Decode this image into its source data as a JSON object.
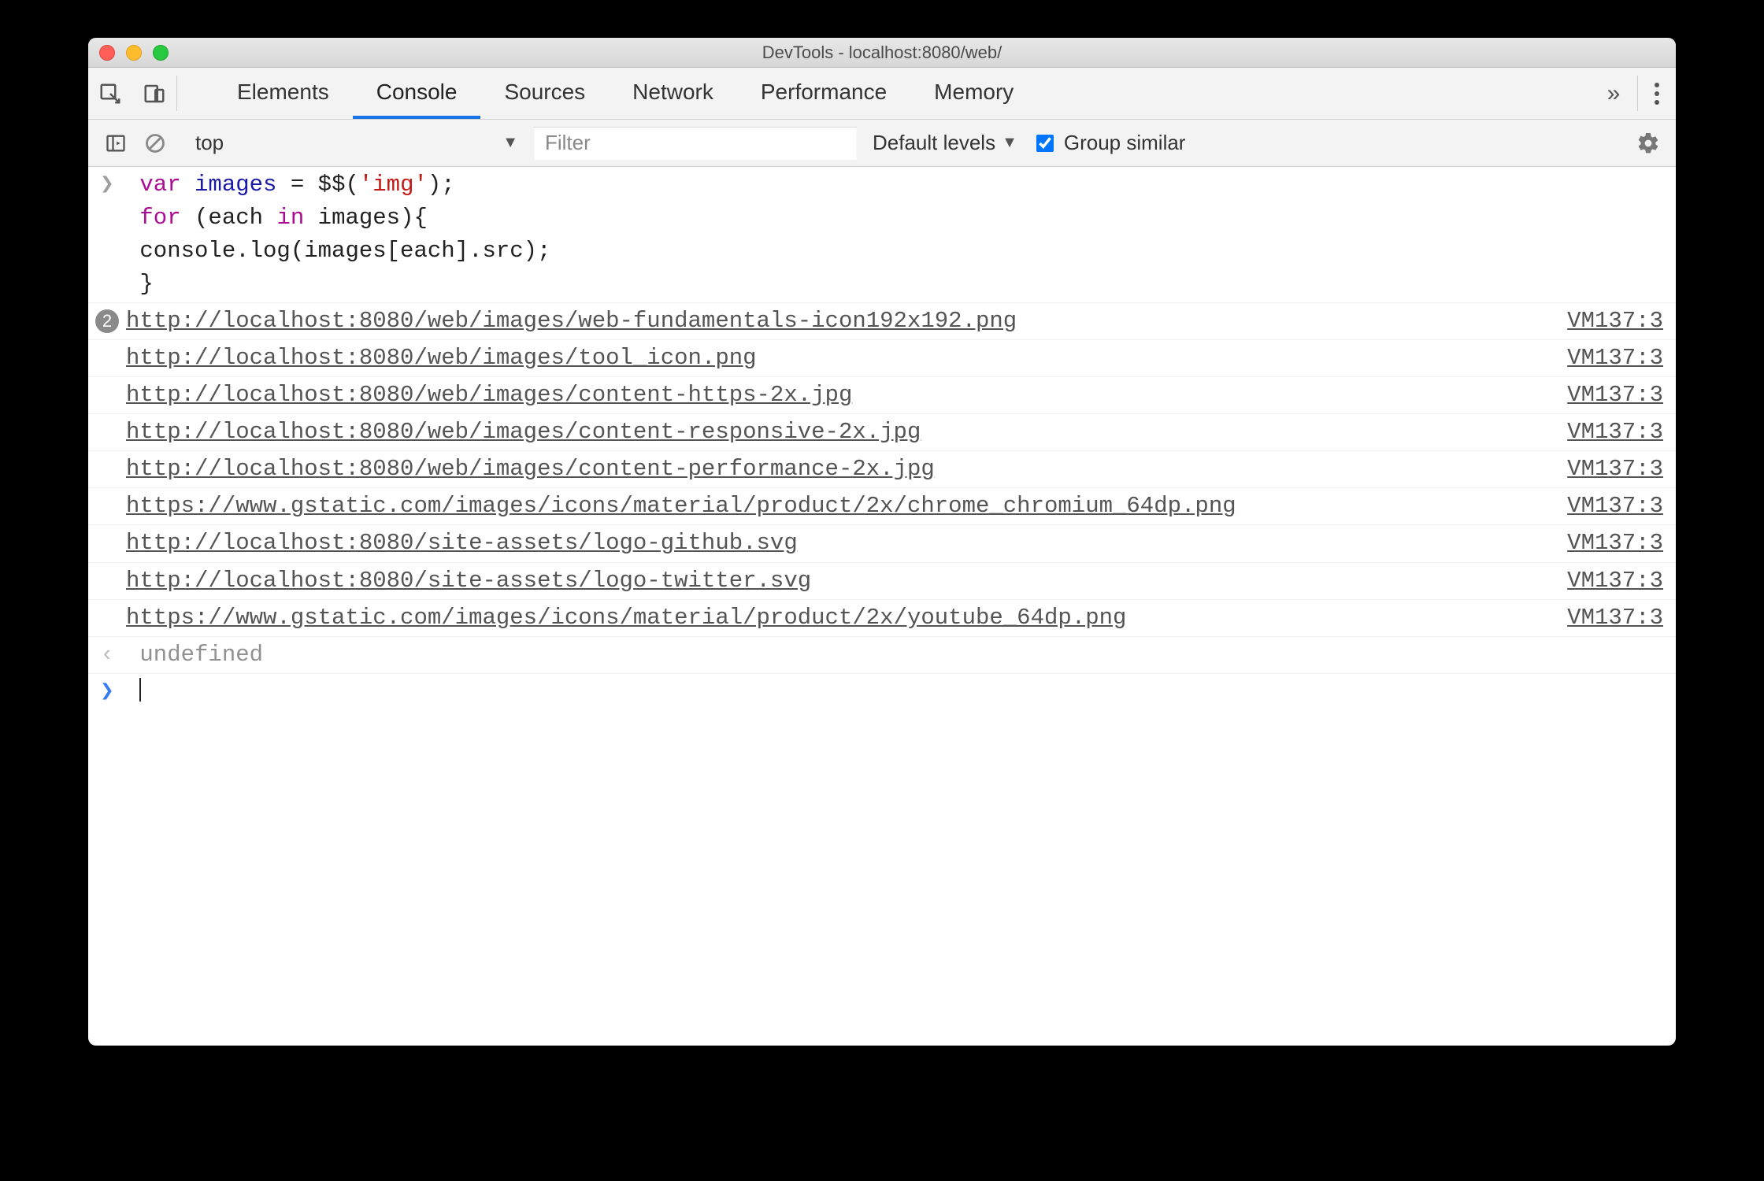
{
  "window": {
    "title": "DevTools - localhost:8080/web/"
  },
  "tabs": {
    "items": [
      "Elements",
      "Console",
      "Sources",
      "Network",
      "Performance",
      "Memory"
    ],
    "active": 1,
    "overflow_glyph": "»"
  },
  "toolbar": {
    "context": "top",
    "filter_placeholder": "Filter",
    "levels_label": "Default levels",
    "group_label": "Group similar",
    "group_checked": true
  },
  "console": {
    "input_code": {
      "l1": {
        "kw": "var",
        "name": " images ",
        "rest": "= $$(",
        "str": "'img'",
        "tail": ");"
      },
      "l2": {
        "kw": "for",
        "rest1": " (each ",
        "kw2": "in",
        "rest2": " images){"
      },
      "l3": "    console.log(images[each].src);",
      "l4": "}"
    },
    "logs": [
      {
        "badge": "2",
        "url": "http://localhost:8080/web/images/web-fundamentals-icon192x192.png",
        "src": "VM137:3"
      },
      {
        "url": "http://localhost:8080/web/images/tool_icon.png",
        "src": "VM137:3"
      },
      {
        "url": "http://localhost:8080/web/images/content-https-2x.jpg",
        "src": "VM137:3"
      },
      {
        "url": "http://localhost:8080/web/images/content-responsive-2x.jpg",
        "src": "VM137:3"
      },
      {
        "url": "http://localhost:8080/web/images/content-performance-2x.jpg",
        "src": "VM137:3"
      },
      {
        "url": "https://www.gstatic.com/images/icons/material/product/2x/chrome_chromium_64dp.png",
        "src": "VM137:3"
      },
      {
        "url": "http://localhost:8080/site-assets/logo-github.svg",
        "src": "VM137:3"
      },
      {
        "url": "http://localhost:8080/site-assets/logo-twitter.svg",
        "src": "VM137:3"
      },
      {
        "url": "https://www.gstatic.com/images/icons/material/product/2x/youtube_64dp.png",
        "src": "VM137:3"
      }
    ],
    "result": "undefined",
    "prompt_glyph": "❯",
    "return_glyph": "‹"
  }
}
